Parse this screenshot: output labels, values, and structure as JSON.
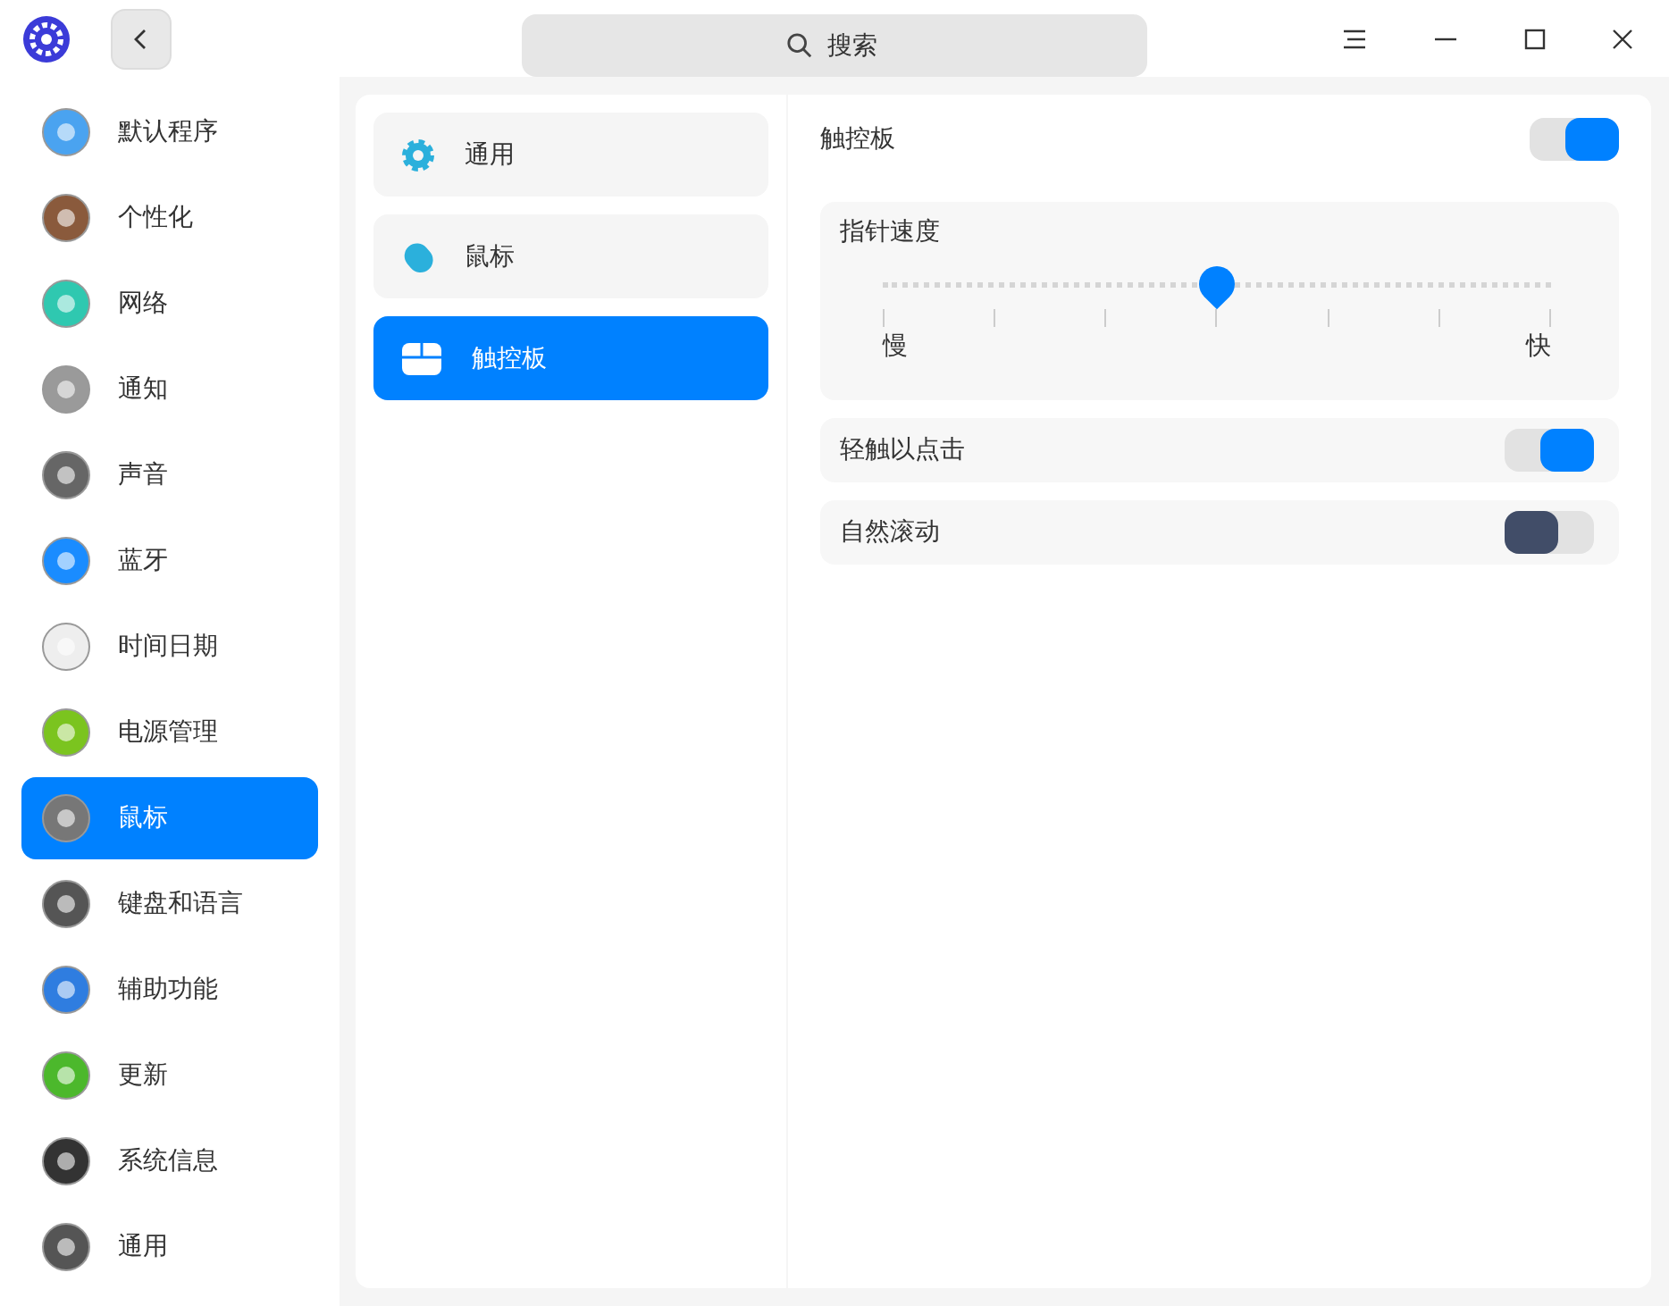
{
  "search": {
    "placeholder": "搜索"
  },
  "sidebar": {
    "items": [
      {
        "label": "默认程序",
        "selected": false
      },
      {
        "label": "个性化",
        "selected": false
      },
      {
        "label": "网络",
        "selected": false
      },
      {
        "label": "通知",
        "selected": false
      },
      {
        "label": "声音",
        "selected": false
      },
      {
        "label": "蓝牙",
        "selected": false
      },
      {
        "label": "时间日期",
        "selected": false
      },
      {
        "label": "电源管理",
        "selected": false
      },
      {
        "label": "鼠标",
        "selected": true
      },
      {
        "label": "键盘和语言",
        "selected": false
      },
      {
        "label": "辅助功能",
        "selected": false
      },
      {
        "label": "更新",
        "selected": false
      },
      {
        "label": "系统信息",
        "selected": false
      },
      {
        "label": "通用",
        "selected": false
      }
    ]
  },
  "subnav": {
    "items": [
      {
        "label": "通用",
        "selected": false
      },
      {
        "label": "鼠标",
        "selected": false
      },
      {
        "label": "触控板",
        "selected": true
      }
    ]
  },
  "touchpad": {
    "label": "触控板",
    "on": true
  },
  "pointer_speed": {
    "label": "指针速度",
    "level": 0.5,
    "min_label": "慢",
    "max_label": "快"
  },
  "settings": [
    {
      "label": "轻触以点击",
      "on": true
    },
    {
      "label": "自然滚动",
      "on": false
    }
  ]
}
